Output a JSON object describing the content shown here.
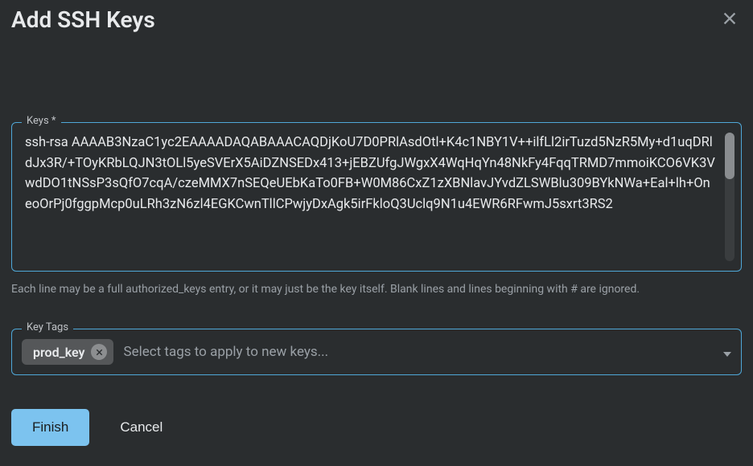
{
  "header": {
    "title": "Add SSH Keys"
  },
  "keys_field": {
    "legend": "Keys *",
    "value": "ssh-rsa AAAAB3NzaC1yc2EAAAADAQABAAACAQDjKoU7D0PRlAsdOtl+K4c1NBY1V++ilfLl2irTuzd5NzR5My+d1uqDRldJx3R/+TOyKRbLQJN3tOLl5yeSVErX5AiDZNSEDx413+jEBZUfgJWgxX4WqHqYn48NkFy4FqqTRMD7mmoiKCO6VK3VwdDO1tNSsP3sQfO7cqA/czeMMX7nSEQeUEbKaTo0FB+W0M86CxZ1zXBNlavJYvdZLSWBlu309BYkNWa+Eal+lh+OneoOrPj0fggpMcp0uLRh3zN6zl4EGKCwnTllCPwjyDxAgk5irFkloQ3Uclq9N1u4EWR6RFwmJ5sxrt3RS2",
    "help_text": "Each line may be a full authorized_keys entry, or it may just be the key itself. Blank lines and lines beginning with # are ignored."
  },
  "tags_field": {
    "legend": "Key Tags",
    "chips": [
      {
        "label": "prod_key"
      }
    ],
    "placeholder": "Select tags to apply to new keys..."
  },
  "footer": {
    "primary_label": "Finish",
    "cancel_label": "Cancel"
  }
}
